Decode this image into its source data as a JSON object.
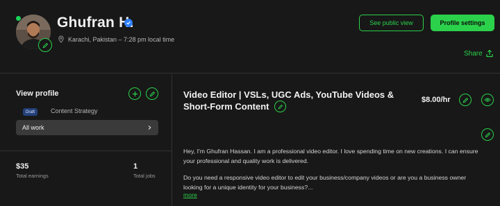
{
  "profile": {
    "name": "Ghufran H.",
    "location": "Karachi, Pakistan – 7:28 pm local time"
  },
  "header": {
    "public_view_label": "See public view",
    "settings_label": "Profile settings",
    "share_label": "Share"
  },
  "sidebar": {
    "view_profile_label": "View profile",
    "draft_badge": "Draft",
    "specialized_profile": "Content Strategy",
    "all_work_label": "All work"
  },
  "stats": {
    "earnings_value": "$35",
    "earnings_label": "Total earnings",
    "jobs_value": "1",
    "jobs_label": "Total jobs"
  },
  "main": {
    "title": "Video Editor | VSLs, UGC Ads, YouTube Videos & Short-Form Content",
    "rate": "$8.00/hr",
    "bio_p1": "Hey, I'm Ghufran Hassan. I am a professional video editor. I love spending time on new creations. I can ensure your professional and quality work is delivered.",
    "bio_p2": "Do you need a responsive video editor to edit your business/company videos or are you a business owner looking for a unique identity for your business?...",
    "more_label": "more"
  },
  "colors": {
    "accent": "#2bd14b",
    "background": "#181818",
    "verified": "#2f80ff",
    "draft_badge": "#23407a"
  }
}
